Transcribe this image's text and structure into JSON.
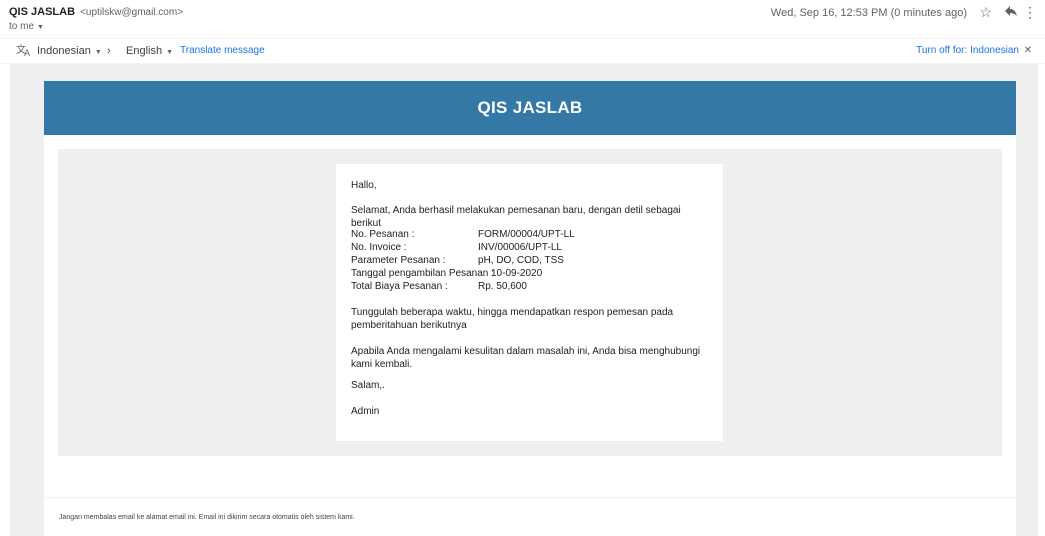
{
  "header": {
    "sender_name": "QIS JASLAB",
    "sender_email": "<uptilskw@gmail.com>",
    "to_label": "to me",
    "date": "Wed, Sep 16, 12:53 PM (0 minutes ago)",
    "icons": [
      "star-icon",
      "reply-icon",
      "more-vert-icon"
    ]
  },
  "translate": {
    "from_lang": "Indonesian",
    "arrow": "›",
    "to_lang": "English",
    "action": "Translate message",
    "turn_off": "Turn off for: Indonesian"
  },
  "email": {
    "banner_title": "QIS JASLAB",
    "greeting": "Hallo,",
    "intro": "Selamat, Anda berhasil melakukan pemesanan baru, dengan detil sebagai berikut",
    "details": [
      {
        "label": "No. Pesanan :",
        "value": "FORM/00004/UPT-LL"
      },
      {
        "label": "No. Invoice :",
        "value": "INV/00006/UPT-LL"
      },
      {
        "label": "Parameter Pesanan :",
        "value": "pH, DO, COD, TSS"
      },
      {
        "label": "Tanggal pengambilan Pesanan :",
        "value": "10-09-2020"
      },
      {
        "label": "Total Biaya Pesanan :",
        "value": "Rp. 50,600"
      }
    ],
    "wait_text": "Tunggulah beberapa waktu, hingga mendapatkan respon pemesan pada pemberitahuan berikutnya",
    "help_text": "Apabila Anda mengalami kesulitan dalam masalah ini, Anda bisa menghubungi kami kembali.",
    "closing": "Salam,.",
    "signature": "Admin",
    "footer": "Jangan membalas email ke alamat email ini. Email ini dikirim secara otomatis oleh sistem kami."
  },
  "colors": {
    "banner": "#3478a6",
    "link": "#1a73e8",
    "background": "#efefef"
  }
}
